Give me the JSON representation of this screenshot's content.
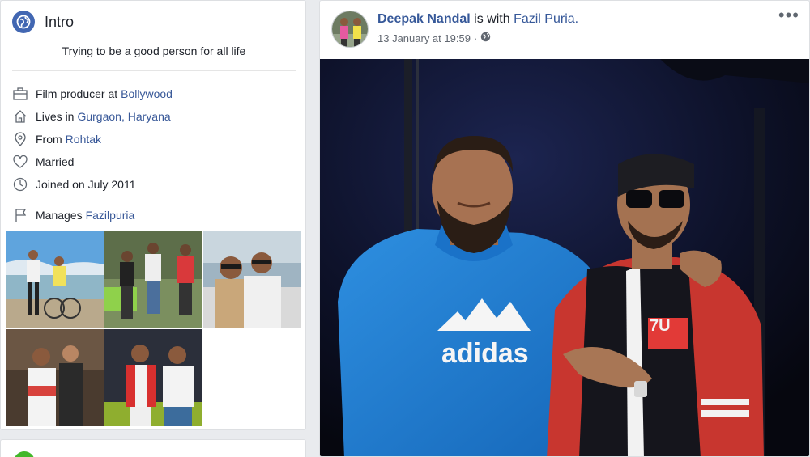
{
  "intro": {
    "title": "Intro",
    "bio": "Trying to be a good person for all life",
    "items": [
      {
        "icon": "briefcase-icon",
        "text": "Film producer at",
        "link": "Bollywood"
      },
      {
        "icon": "home-icon",
        "text": "Lives in",
        "link": "Gurgaon, Haryana"
      },
      {
        "icon": "location-pin-icon",
        "text": "From",
        "link": "Rohtak"
      },
      {
        "icon": "heart-icon",
        "text": "Married",
        "link": ""
      },
      {
        "icon": "clock-icon",
        "text": "Joined on July 2011",
        "link": ""
      },
      {
        "icon": "flag-icon",
        "text": "Manages",
        "link": "Fazilpuria"
      }
    ],
    "photo_count": 5
  },
  "post": {
    "author": "Deepak Nandal",
    "with_text": "is with",
    "with_name": "Fazil Puria.",
    "timestamp": "13 January at 19:59",
    "separator": "·",
    "more_label": "•••",
    "photo_alt": "Two men posing, one in blue adidas hoodie, one in sunglasses and red bomber jacket"
  },
  "colors": {
    "link": "#385898",
    "brand": "#4267b2",
    "background": "#e9ebee"
  }
}
